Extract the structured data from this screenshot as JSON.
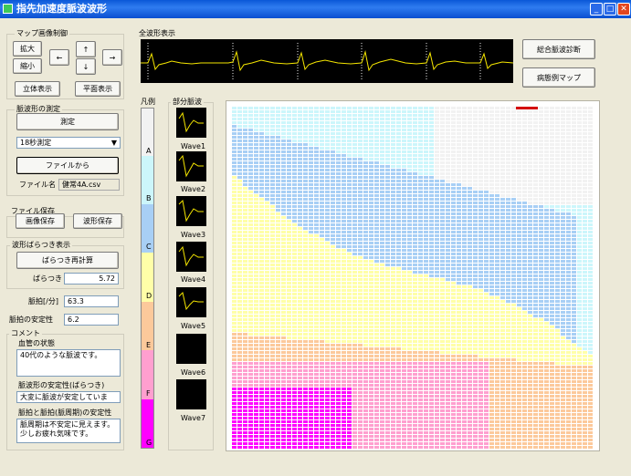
{
  "window": {
    "title": "指先加速度脈波波形"
  },
  "map_control": {
    "title": "マップ画像制御",
    "zoom_in": "拡大",
    "zoom_out": "縮小",
    "up": "↑",
    "down": "↓",
    "left": "←",
    "right": "→",
    "view_3d": "立体表示",
    "view_2d": "平面表示"
  },
  "measure": {
    "title": "脈波形の測定",
    "measure_button": "測定",
    "mode": "18秒測定",
    "from_file": "ファイルから",
    "file_label": "ファイル名",
    "file_value": "健常4A.csv"
  },
  "save": {
    "title": "ファイル保存",
    "image": "画像保存",
    "wave": "波形保存"
  },
  "variation": {
    "title": "波形ばらつき表示",
    "recalc": "ばらつき再計算",
    "label": "ばらつき",
    "value": "5.72"
  },
  "pulse": {
    "label": "脈拍[/分]",
    "value": "63.3"
  },
  "stability": {
    "label": "脈拍の安定性",
    "value": "6.2"
  },
  "comment": {
    "title": "コメント",
    "vessel_label": "血管の状態",
    "vessel_text": "40代のような脈波です。",
    "shape_label": "脈波形の安定性(ばらつき)",
    "shape_text": "大変に脈波が安定しています。",
    "interval_label": "脈拍と脈拍(脈周期)の安定性",
    "interval_text": "脈周期は不安定に見えます。少しお疲れ気味です。"
  },
  "overview": {
    "title": "全波形表示"
  },
  "buttons": {
    "diagnosis": "総合脈波診断",
    "case_map": "病態例マップ"
  },
  "legend": {
    "title": "凡例",
    "labels": [
      "A",
      "B",
      "C",
      "D",
      "E",
      "F",
      "G"
    ],
    "colors": [
      "#f2f2f2",
      "#ccf6fb",
      "#a8cff5",
      "#ffffa8",
      "#fcc99b",
      "#ff9fcf",
      "#ff00ff"
    ]
  },
  "partial": {
    "title": "部分脈波",
    "waves": [
      "Wave1",
      "Wave2",
      "Wave3",
      "Wave4",
      "Wave5",
      "Wave6",
      "Wave7"
    ]
  }
}
